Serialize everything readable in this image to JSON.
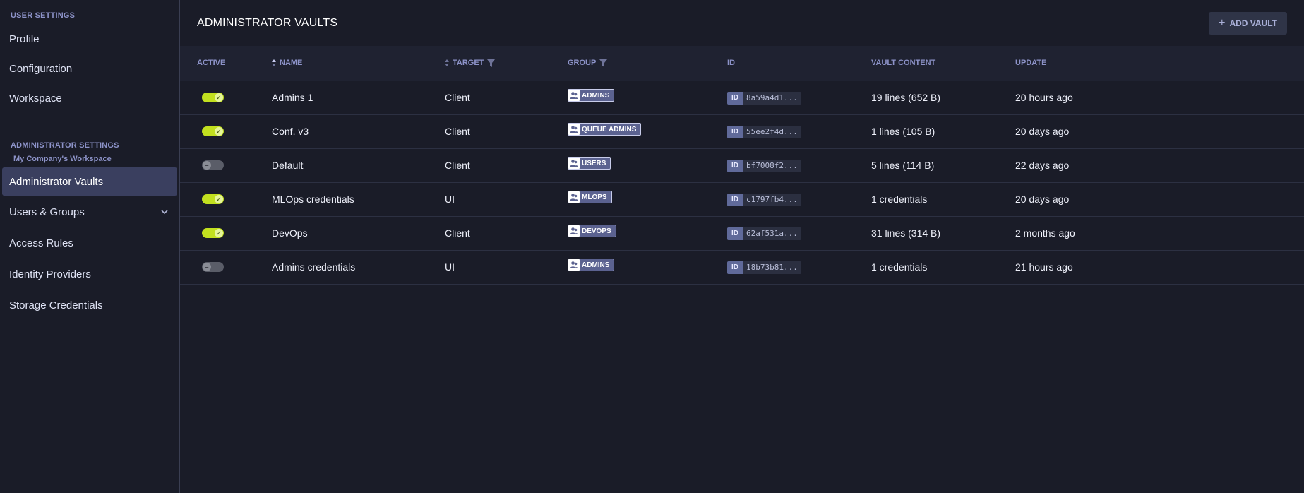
{
  "sidebar": {
    "user_settings_title": "USER SETTINGS",
    "user_items": [
      {
        "label": "Profile"
      },
      {
        "label": "Configuration"
      },
      {
        "label": "Workspace"
      }
    ],
    "admin_settings_title": "ADMINISTRATOR SETTINGS",
    "workspace_name": "My Company's Workspace",
    "admin_items": [
      {
        "label": "Administrator Vaults",
        "active": true
      },
      {
        "label": "Users & Groups",
        "expandable": true
      },
      {
        "label": "Access Rules"
      },
      {
        "label": "Identity Providers"
      },
      {
        "label": "Storage Credentials"
      }
    ]
  },
  "header": {
    "title": "ADMINISTRATOR VAULTS",
    "add_button_label": "ADD VAULT",
    "add_button_icon": "+"
  },
  "table": {
    "columns": {
      "active": "ACTIVE",
      "name": "NAME",
      "target": "TARGET",
      "group": "GROUP",
      "id": "ID",
      "content": "VAULT CONTENT",
      "update": "UPDATE"
    },
    "id_label": "ID",
    "rows": [
      {
        "active": true,
        "name": "Admins 1",
        "target": "Client",
        "group": "ADMINS",
        "id": "8a59a4d1...",
        "content": "19 lines (652 B)",
        "update": "20 hours ago"
      },
      {
        "active": true,
        "name": "Conf. v3",
        "target": "Client",
        "group": "QUEUE ADMINS",
        "id": "55ee2f4d...",
        "content": "1 lines (105 B)",
        "update": "20 days ago"
      },
      {
        "active": false,
        "name": "Default",
        "target": "Client",
        "group": "USERS",
        "id": "bf7008f2...",
        "content": "5 lines (114 B)",
        "update": "22 days ago"
      },
      {
        "active": true,
        "name": "MLOps credentials",
        "target": "UI",
        "group": "MLOPS",
        "id": "c1797fb4...",
        "content": "1 credentials",
        "update": "20 days ago"
      },
      {
        "active": true,
        "name": "DevOps",
        "target": "Client",
        "group": "DEVOPS",
        "id": "62af531a...",
        "content": "31 lines (314 B)",
        "update": "2 months ago"
      },
      {
        "active": false,
        "name": "Admins credentials",
        "target": "UI",
        "group": "ADMINS",
        "id": "18b73b81...",
        "content": "1 credentials",
        "update": "21 hours ago"
      }
    ]
  },
  "colors": {
    "background": "#1a1c28",
    "toggle_on": "#c2e01f",
    "toggle_off": "#5a5d68",
    "accent_text": "#8d93c9",
    "badge_bg": "#5b6290"
  }
}
